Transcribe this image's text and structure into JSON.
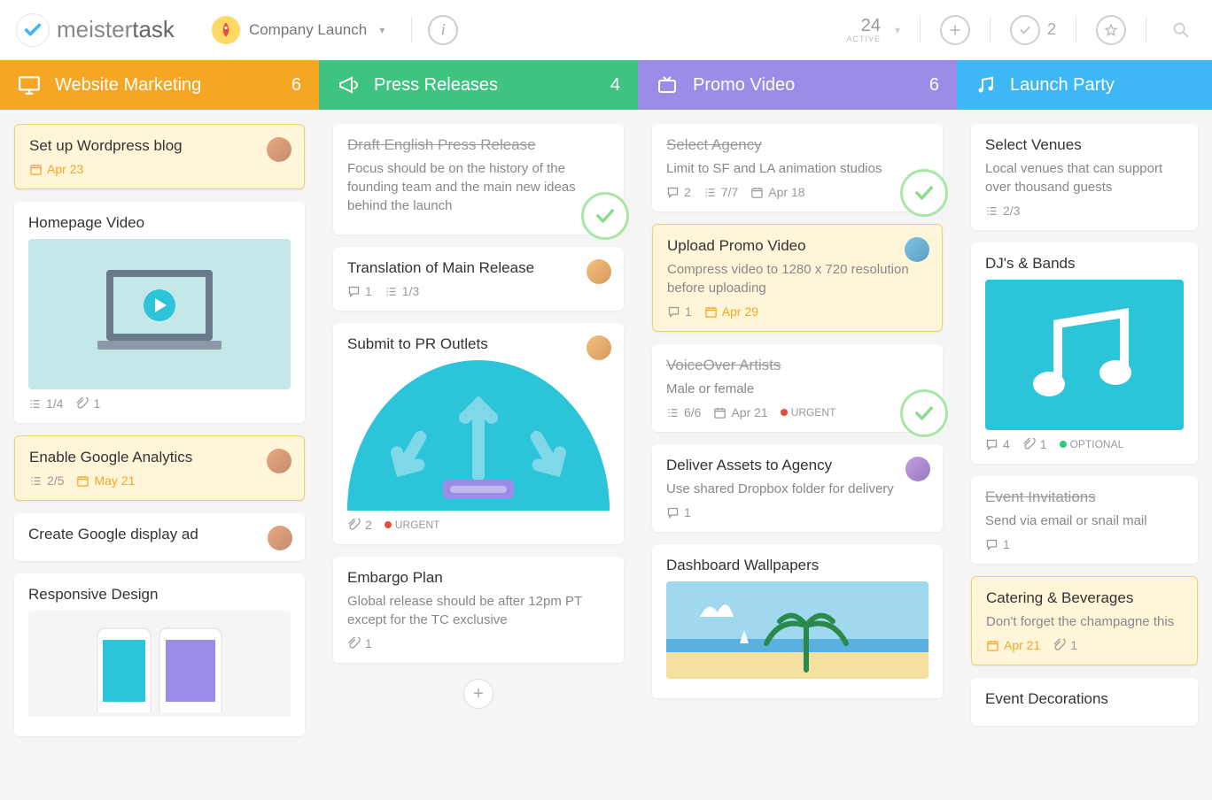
{
  "header": {
    "logo_text_light": "meister",
    "logo_text_bold": "task",
    "project_name": "Company Launch",
    "active_count": "24",
    "active_label": "ACTIVE",
    "check_count": "2"
  },
  "columns": [
    {
      "title": "Website Marketing",
      "count": "6",
      "color": "orange",
      "icon": "monitor",
      "cards": [
        {
          "title": "Set up Wordpress blog",
          "highlighted": true,
          "avatar": "a1",
          "date": "Apr 23",
          "date_orange": true
        },
        {
          "title": "Homepage Video",
          "image": "laptop",
          "checklist": "1/4",
          "attachments": "1"
        },
        {
          "title": "Enable Google Analytics",
          "highlighted": true,
          "avatar": "a1",
          "checklist": "2/5",
          "date": "May 21",
          "date_orange": true
        },
        {
          "title": "Create Google display ad",
          "avatar": "a1"
        },
        {
          "title": "Responsive Design",
          "image": "phones"
        }
      ]
    },
    {
      "title": "Press Releases",
      "count": "4",
      "color": "green",
      "icon": "megaphone",
      "cards": [
        {
          "title": "Draft English Press Release",
          "done": true,
          "desc": "Focus should be on the history of the founding team and the main new ideas behind the launch",
          "check_badge": true
        },
        {
          "title": "Translation of Main Release",
          "avatar": "a2",
          "comments": "1",
          "checklist": "1/3"
        },
        {
          "title": "Submit to PR Outlets",
          "avatar": "a2",
          "image": "pr-arrows",
          "attachments": "2",
          "urgent": "URGENT"
        },
        {
          "title": "Embargo Plan",
          "desc": "Global release should be after 12pm PT except for the TC exclusive",
          "attachments": "1"
        }
      ],
      "add_button": true
    },
    {
      "title": "Promo Video",
      "count": "6",
      "color": "purple",
      "icon": "tv",
      "cards": [
        {
          "title": "Select Agency",
          "done": true,
          "desc": "Limit to SF and LA animation studios",
          "comments": "2",
          "checklist": "7/7",
          "date": "Apr 18",
          "check_badge": true
        },
        {
          "title": "Upload Promo Video",
          "highlighted": true,
          "avatar": "a3",
          "desc": "Compress video to 1280 x 720 resolution before uploading",
          "comments": "1",
          "date": "Apr 29",
          "date_orange": true
        },
        {
          "title": "VoiceOver Artists",
          "done": true,
          "desc": "Male or female",
          "checklist": "6/6",
          "date": "Apr 21",
          "urgent": "URGENT",
          "check_badge": true
        },
        {
          "title": "Deliver Assets to Agency",
          "avatar": "a4",
          "desc": "Use shared Dropbox folder for delivery",
          "comments": "1"
        },
        {
          "title": "Dashboard Wallpapers",
          "image": "beach"
        }
      ]
    },
    {
      "title": "Launch Party",
      "count": "",
      "color": "blue",
      "icon": "music",
      "cards": [
        {
          "title": "Select Venues",
          "desc": "Local venues that can support over thousand guests",
          "checklist": "2/3"
        },
        {
          "title": "DJ's & Bands",
          "image": "music",
          "comments": "4",
          "attachments": "1",
          "optional": "OPTIONAL"
        },
        {
          "title": "Event Invitations",
          "done": true,
          "desc": "Send via email or snail mail",
          "comments": "1"
        },
        {
          "title": "Catering & Beverages",
          "highlighted": true,
          "desc": "Don't forget the champagne this",
          "date": "Apr 21",
          "attachments": "1",
          "date_orange": true
        },
        {
          "title": "Event Decorations",
          "partial": true
        }
      ]
    }
  ]
}
